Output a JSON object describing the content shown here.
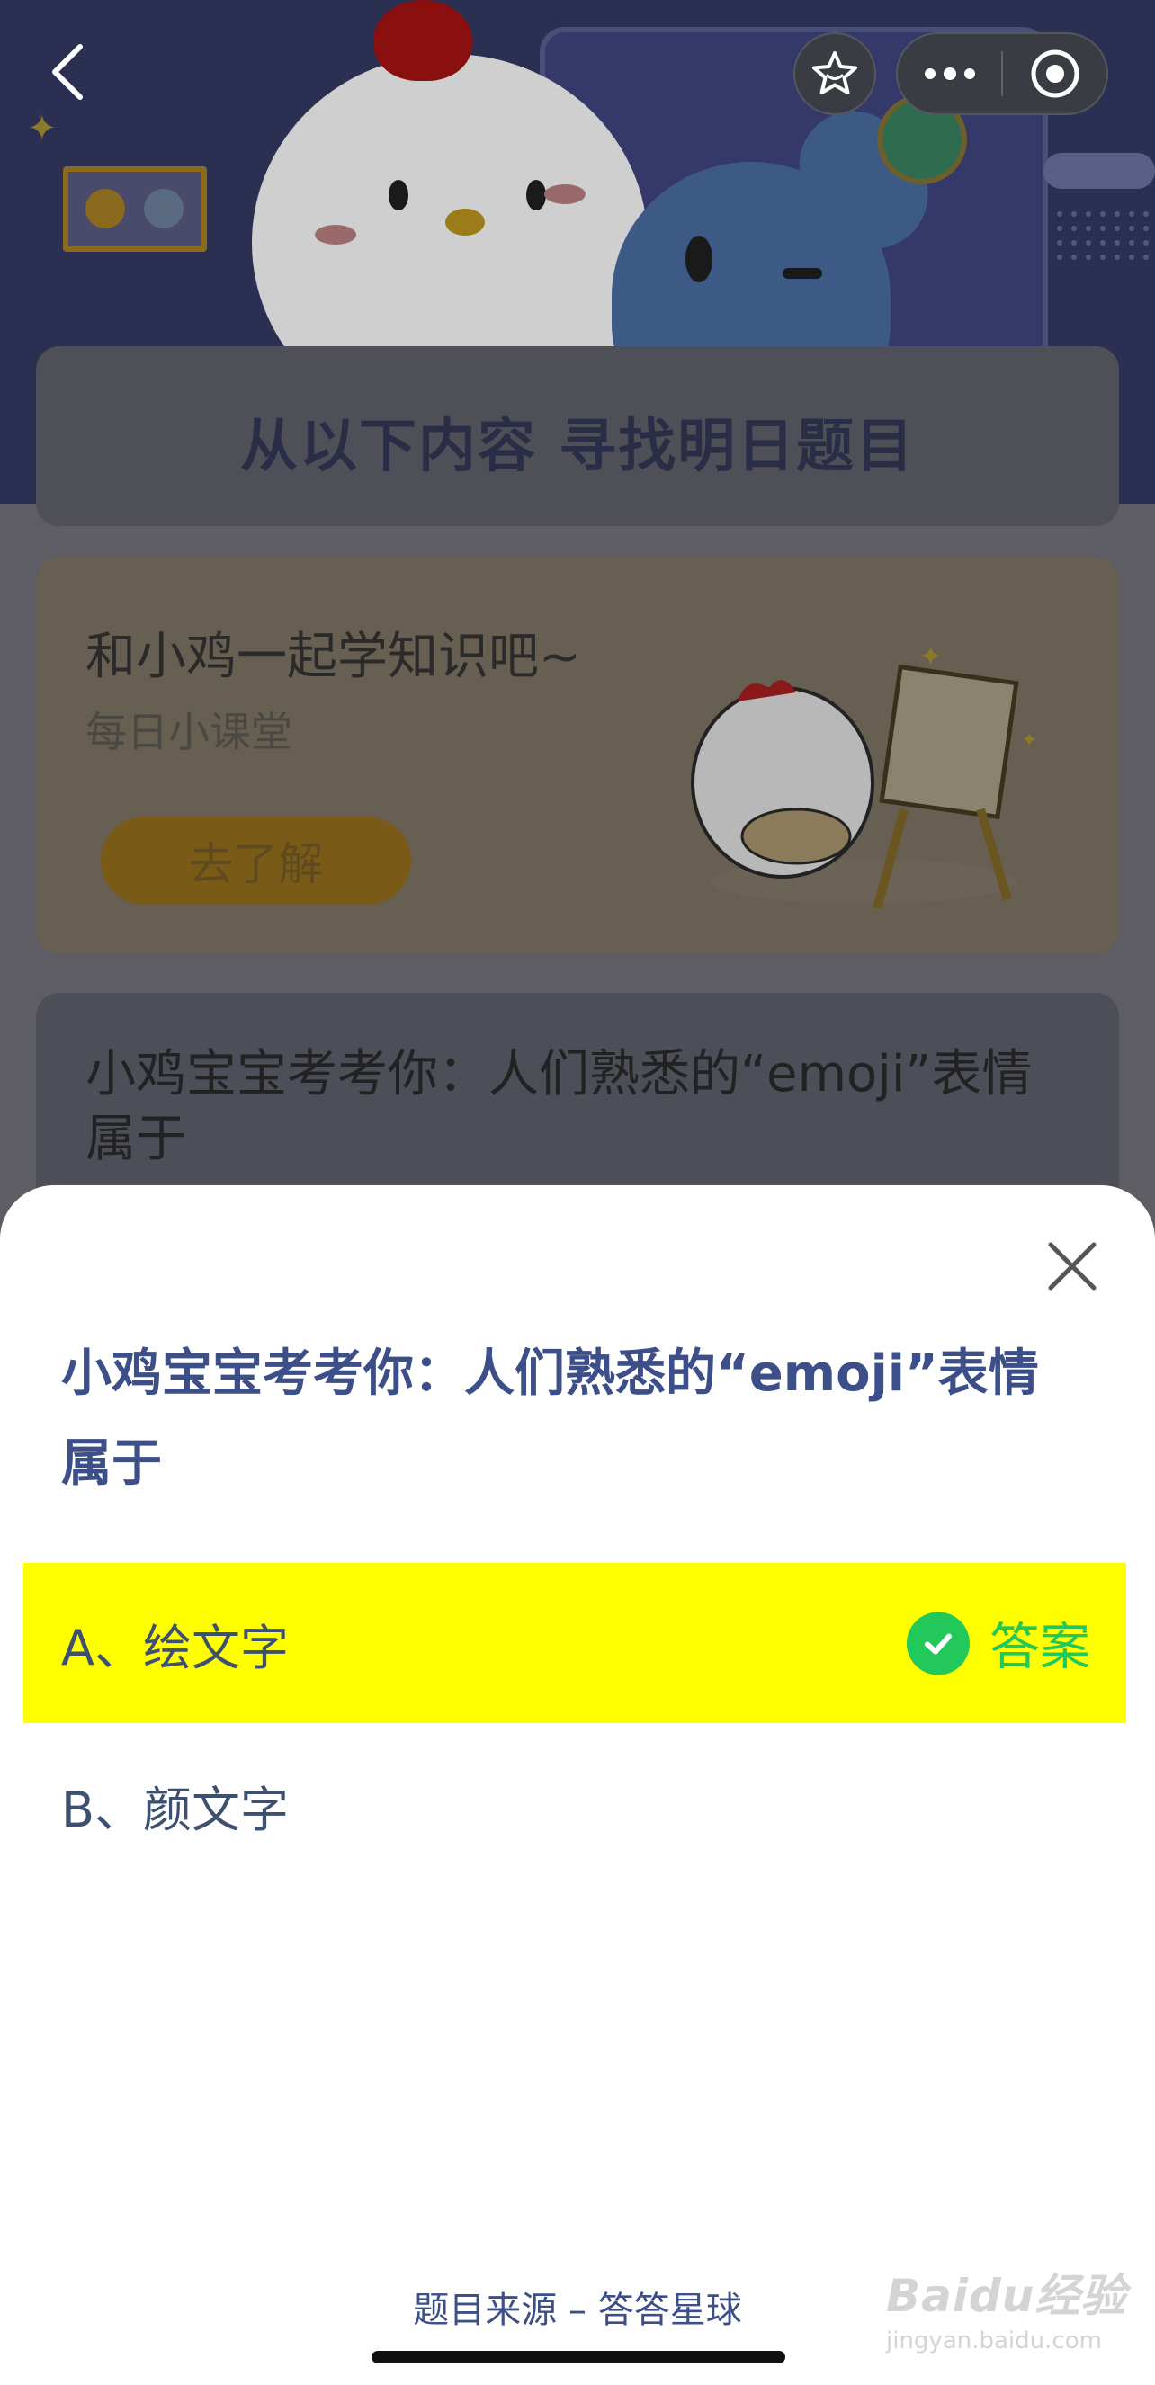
{
  "background": {
    "find_card_title": "从以下内容  寻找明日题目",
    "lesson_card": {
      "heading": "和小鸡一起学知识吧~",
      "subheading": "每日小课堂",
      "button_label": "去了解"
    },
    "quiz_card": {
      "question": "小鸡宝宝考考你：人们熟悉的“emoji”表情属于"
    }
  },
  "sheet": {
    "question": "小鸡宝宝考考你：人们熟悉的“emoji”表情属于",
    "options": [
      {
        "label": "A、绘文字",
        "is_answer": true,
        "answer_text": "答案"
      },
      {
        "label": "B、颜文字",
        "is_answer": false
      }
    ],
    "source": "题目来源 – 答答星球"
  },
  "watermark": {
    "brand": "Baidu经验",
    "sub": "jingyan.baidu.com"
  },
  "colors": {
    "answer_highlight": "#ffff00",
    "answer_green": "#23c85a",
    "question_blue": "#3d4f88"
  },
  "icons": [
    "back-arrow-icon",
    "star-icon",
    "more-dots-icon",
    "target-icon",
    "close-icon",
    "check-icon"
  ]
}
